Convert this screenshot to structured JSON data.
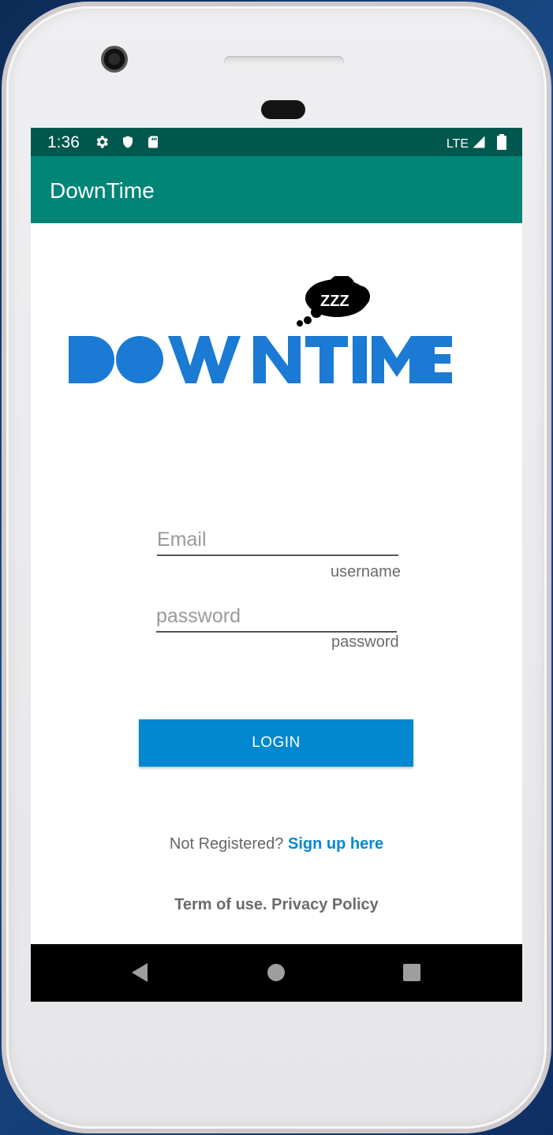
{
  "status_bar": {
    "time": "1:36",
    "network": "LTE",
    "icons": [
      "settings-icon",
      "shield-icon",
      "sd-card-icon",
      "signal-icon",
      "battery-icon"
    ]
  },
  "app_bar": {
    "title": "DownTime"
  },
  "logo": {
    "text": "DOWNTIME",
    "cloud_text": "ZZZ",
    "brand_color": "#1a7ad4"
  },
  "form": {
    "email": {
      "placeholder": "Email",
      "hint": "username",
      "value": ""
    },
    "password": {
      "placeholder": "password",
      "hint": "password",
      "value": ""
    },
    "login_label": "LOGIN"
  },
  "footer": {
    "not_registered": "Not Registered?",
    "signup_link": "Sign up here",
    "terms": "Term of use. Privacy Policy"
  },
  "colors": {
    "status_bar": "#00574d",
    "app_bar": "#008577",
    "accent": "#0288d1"
  },
  "nav_bar": {
    "buttons": [
      "back-icon",
      "home-icon",
      "recents-icon"
    ]
  }
}
